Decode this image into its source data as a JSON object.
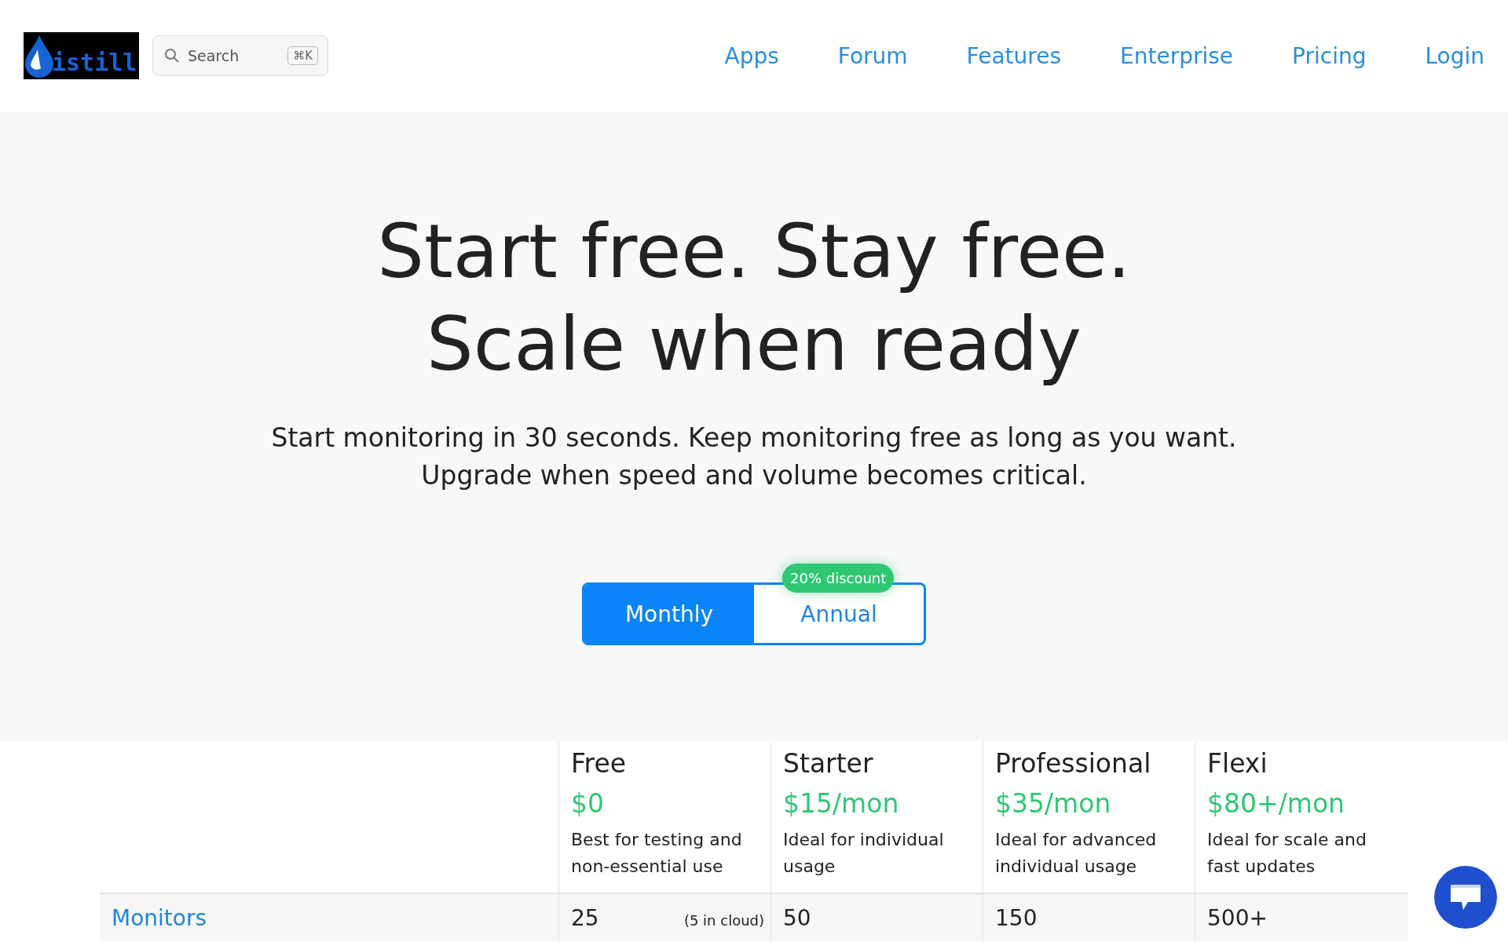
{
  "header": {
    "logo": {
      "text": "istill"
    },
    "search": {
      "placeholder": "Search",
      "shortcut": "⌘K"
    },
    "nav": [
      "Apps",
      "Forum",
      "Features",
      "Enterprise",
      "Pricing",
      "Login"
    ]
  },
  "hero": {
    "title_lines": [
      "Start free. Stay free.",
      "Scale when ready"
    ],
    "subtitle": "Start monitoring in 30 seconds. Keep monitoring free as long as you want. Upgrade when speed and volume becomes critical."
  },
  "billing_toggle": {
    "options": [
      {
        "label": "Monthly",
        "selected": true
      },
      {
        "label": "Annual",
        "selected": false,
        "badge": "20% discount"
      }
    ]
  },
  "plans": [
    {
      "name": "Free",
      "price": "$0",
      "description": "Best for testing and non-essential use"
    },
    {
      "name": "Starter",
      "price": "$15/mon",
      "description": "Ideal for individual usage"
    },
    {
      "name": "Professional",
      "price": "$35/mon",
      "description": "Ideal for advanced individual usage"
    },
    {
      "name": "Flexi",
      "price": "$80+/mon",
      "description": "Ideal for scale and fast updates"
    }
  ],
  "rows": [
    {
      "label": "Monitors",
      "cells": [
        {
          "value": "25",
          "note": "(5 in cloud)"
        },
        {
          "value": "50"
        },
        {
          "value": "150"
        },
        {
          "value": "500+"
        }
      ]
    }
  ]
}
